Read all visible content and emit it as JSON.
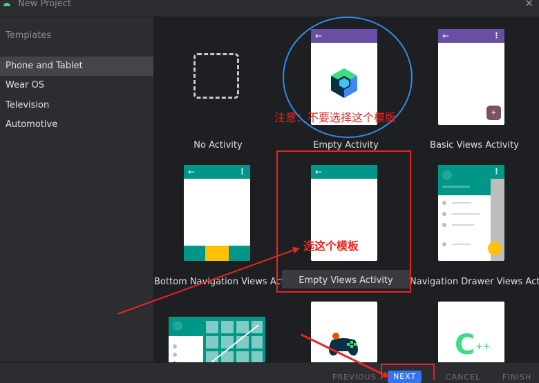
{
  "window": {
    "title": "New Project",
    "close_glyph": "✕"
  },
  "sidebar": {
    "heading": "Templates",
    "items": [
      {
        "label": "Phone and Tablet",
        "selected": true
      },
      {
        "label": "Wear OS"
      },
      {
        "label": "Television"
      },
      {
        "label": "Automotive"
      }
    ]
  },
  "templates": [
    {
      "label": "No Activity"
    },
    {
      "label": "Empty Activity"
    },
    {
      "label": "Basic Views Activity"
    },
    {
      "label": "Bottom Navigation Views Acti…"
    },
    {
      "label": "Empty Views Activity",
      "selected": true
    },
    {
      "label": "Navigation Drawer Views Acti…"
    }
  ],
  "glyphs": {
    "back": "←",
    "menu": "⋮",
    "plus": "+",
    "cpp": "C",
    "cpp_plus": "++"
  },
  "buttons": {
    "previous": "PREVIOUS",
    "next": "NEXT",
    "cancel": "CANCEL",
    "finish": "FINISH"
  },
  "annotations": {
    "warning": "注意：不要选择这个模版",
    "choose": "选这个模板"
  },
  "colors": {
    "purple": "#6750a4",
    "teal": "#009688",
    "accent": "#3574f0",
    "annot_red": "#e8261f",
    "annot_blue": "#2e8de6"
  }
}
